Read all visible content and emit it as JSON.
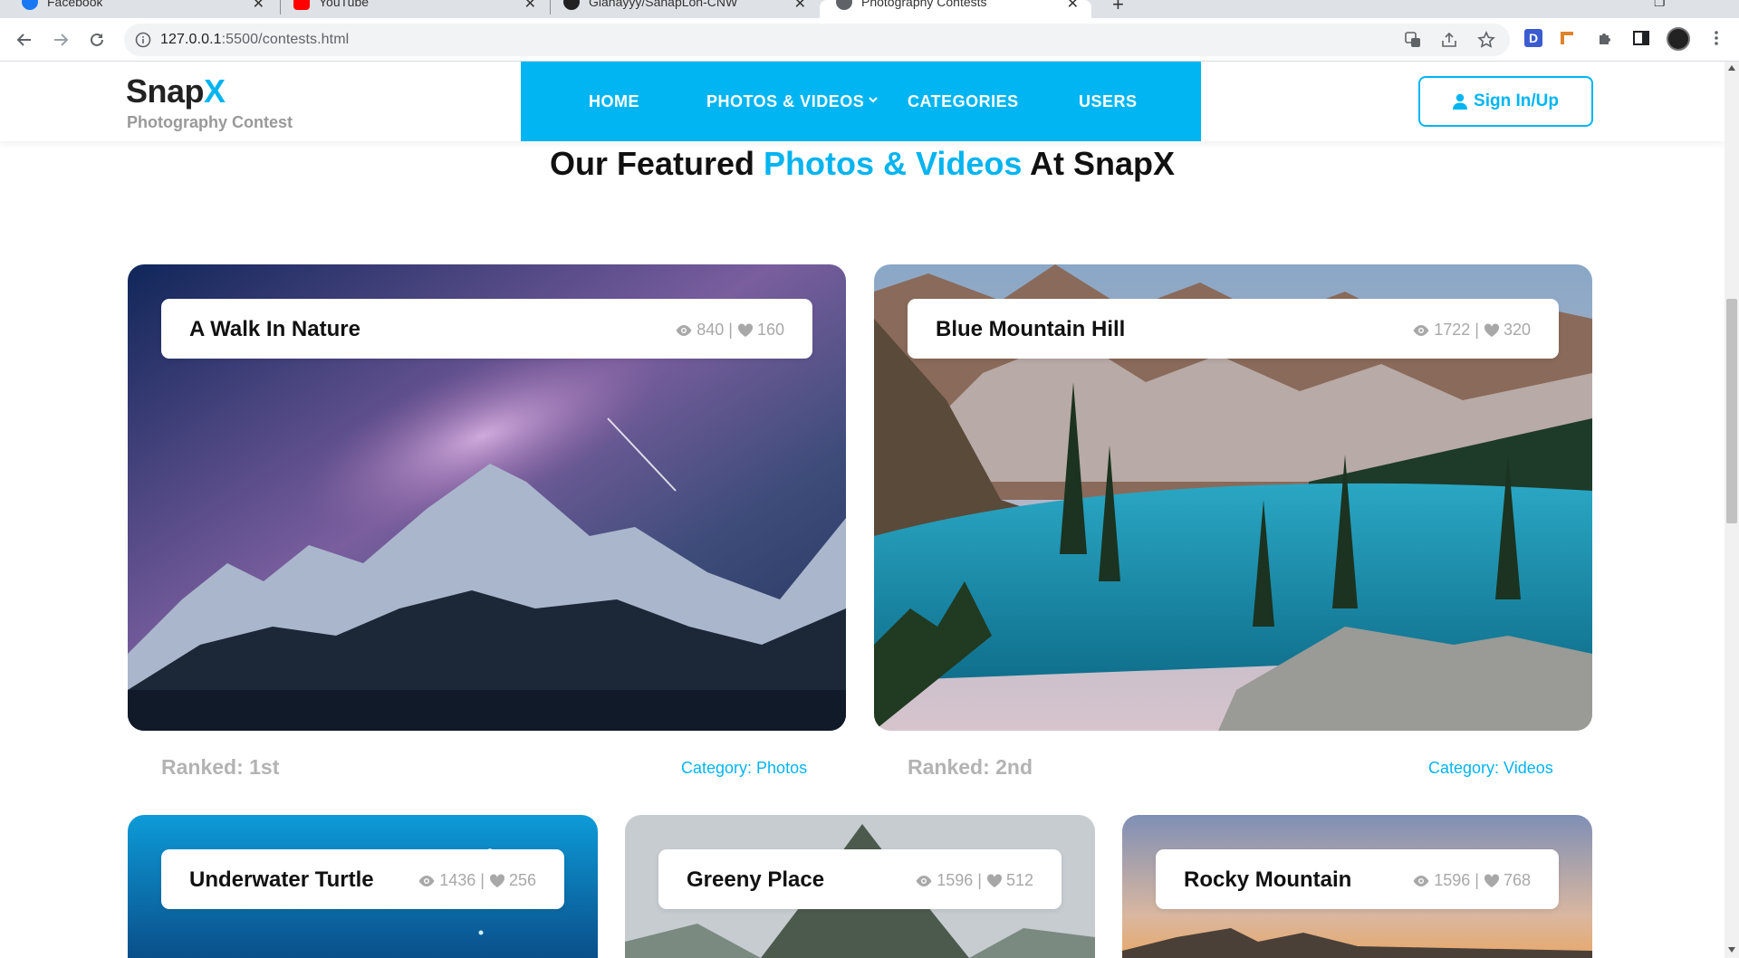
{
  "browser": {
    "tabs": [
      {
        "title": "Facebook",
        "icon": "facebook-icon",
        "color": "#1877f2"
      },
      {
        "title": "YouTube",
        "icon": "youtube-icon",
        "color": "#ff0000"
      },
      {
        "title": "Gianayyy/SanapLon-CNW",
        "icon": "github-icon",
        "color": "#222222"
      },
      {
        "title": "Photography Contests",
        "icon": "globe-icon",
        "color": "#5f6368",
        "active": true
      }
    ],
    "url_host": "127.0.0.1",
    "url_rest": ":5500/contests.html"
  },
  "site": {
    "logo": {
      "main": "Snap",
      "accent": "X",
      "subtitle": "Photography Contest"
    },
    "nav": {
      "home": "HOME",
      "photos_videos": "PHOTOS & VIDEOS",
      "categories": "CATEGORIES",
      "users": "USERS"
    },
    "signin_label": "Sign In/Up",
    "section_title": {
      "before": "Our Featured ",
      "highlight": "Photos & Videos",
      "after": " At SnapX"
    },
    "accent_color": "#00b5f1"
  },
  "featured": [
    {
      "title": "A Walk In Nature",
      "views": "840",
      "likes": "160",
      "rank": "Ranked: 1st",
      "category": "Category: Photos"
    },
    {
      "title": "Blue Mountain Hill",
      "views": "1722",
      "likes": "320",
      "rank": "Ranked: 2nd",
      "category": "Category: Videos"
    }
  ],
  "grid": [
    {
      "title": "Underwater Turtle",
      "views": "1436",
      "likes": "256"
    },
    {
      "title": "Greeny Place",
      "views": "1596",
      "likes": "512"
    },
    {
      "title": "Rocky Mountain",
      "views": "1596",
      "likes": "768"
    }
  ],
  "separator": "|"
}
